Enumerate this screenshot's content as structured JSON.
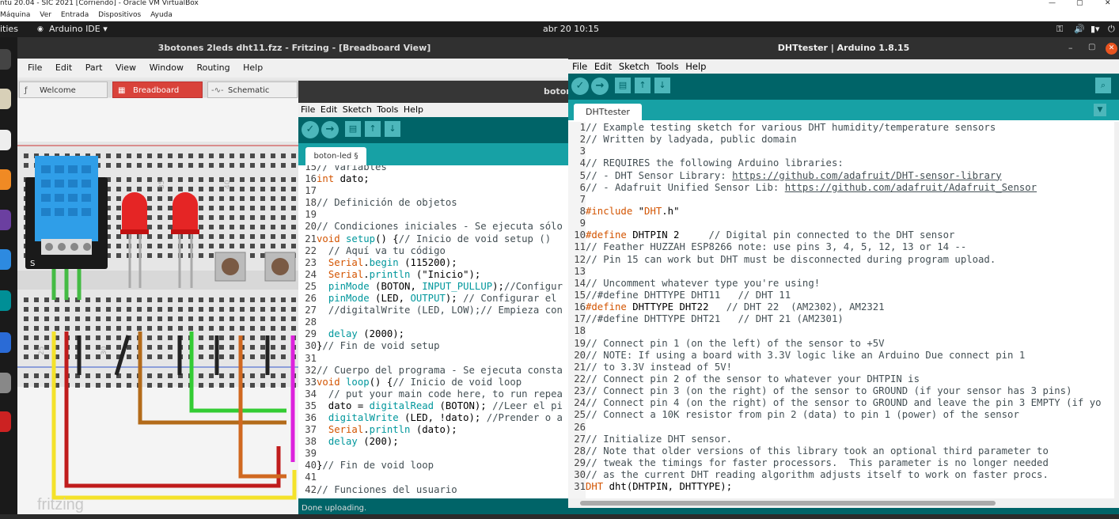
{
  "vb": {
    "title": "ntu 20.04 - SIC 2021 [Corriendo] - Oracle VM VirtualBox",
    "menu": [
      "Máquina",
      "Ver",
      "Entrada",
      "Dispositivos",
      "Ayuda"
    ],
    "window_controls": [
      "—",
      "▢",
      "✕"
    ]
  },
  "topbar": {
    "activities": "ities",
    "app": "Arduino IDE ▾",
    "datetime": "abr 20  10:15"
  },
  "fritzing": {
    "title": "3botones 2leds dht11.fzz - Fritzing - [Breadboard View]",
    "menu": [
      "File",
      "Edit",
      "Part",
      "View",
      "Window",
      "Routing",
      "Help"
    ],
    "tabs": [
      "Welcome",
      "Breadboard",
      "Schematic"
    ],
    "logo": "fritzing",
    "ruler": [
      "25",
      "30",
      "35",
      "40"
    ]
  },
  "small_ide": {
    "title": "boton",
    "menu": [
      "File",
      "Edit",
      "Sketch",
      "Tools",
      "Help"
    ],
    "tab": "boton-led §",
    "status": "Done uploading.",
    "lines": [
      {
        "n": "15",
        "t": "// Variables"
      },
      {
        "n": "16",
        "t": "int dato;"
      },
      {
        "n": "17",
        "t": ""
      },
      {
        "n": "18",
        "t": "// Definición de objetos"
      },
      {
        "n": "19",
        "t": ""
      },
      {
        "n": "20",
        "t": "// Condiciones iniciales - Se ejecuta sólo"
      },
      {
        "n": "21",
        "t": "void setup() {// Inicio de void setup ()"
      },
      {
        "n": "22",
        "t": "  // Aquí va tu código"
      },
      {
        "n": "23",
        "t": "  Serial.begin (115200);"
      },
      {
        "n": "24",
        "t": "  Serial.println (\"Inicio\");"
      },
      {
        "n": "25",
        "t": "  pinMode (BOTON, INPUT_PULLUP);//Configur"
      },
      {
        "n": "26",
        "t": "  pinMode (LED, OUTPUT); // Configurar el"
      },
      {
        "n": "27",
        "t": "  //digitalWrite (LED, LOW);// Empieza con"
      },
      {
        "n": "28",
        "t": ""
      },
      {
        "n": "29",
        "t": "  delay (2000);"
      },
      {
        "n": "30",
        "t": "}// Fin de void setup"
      },
      {
        "n": "31",
        "t": ""
      },
      {
        "n": "32",
        "t": "// Cuerpo del programa - Se ejecuta consta"
      },
      {
        "n": "33",
        "t": "void loop() {// Inicio de void loop"
      },
      {
        "n": "34",
        "t": "  // put your main code here, to run repea"
      },
      {
        "n": "35",
        "t": "  dato = digitalRead (BOTON); //Leer el pi"
      },
      {
        "n": "36",
        "t": "  digitalWrite (LED, !dato); //Prender o a"
      },
      {
        "n": "37",
        "t": "  Serial.println (dato);"
      },
      {
        "n": "38",
        "t": "  delay (200);"
      },
      {
        "n": "39",
        "t": ""
      },
      {
        "n": "40",
        "t": "}// Fin de void loop"
      },
      {
        "n": "41",
        "t": ""
      },
      {
        "n": "42",
        "t": "// Funciones del usuario"
      }
    ]
  },
  "main_ide": {
    "title": "DHTtester | Arduino 1.8.15",
    "menu": [
      "File",
      "Edit",
      "Sketch",
      "Tools",
      "Help"
    ],
    "tab": "DHTtester",
    "lines": [
      {
        "n": "1",
        "t": "// Example testing sketch for various DHT humidity/temperature sensors"
      },
      {
        "n": "2",
        "t": "// Written by ladyada, public domain"
      },
      {
        "n": "3",
        "t": ""
      },
      {
        "n": "4",
        "t": "// REQUIRES the following Arduino libraries:"
      },
      {
        "n": "5",
        "t": "// - DHT Sensor Library: https://github.com/adafruit/DHT-sensor-library"
      },
      {
        "n": "6",
        "t": "// - Adafruit Unified Sensor Lib: https://github.com/adafruit/Adafruit_Sensor"
      },
      {
        "n": "7",
        "t": ""
      },
      {
        "n": "8",
        "t": "#include \"DHT.h\""
      },
      {
        "n": "9",
        "t": ""
      },
      {
        "n": "10",
        "t": "#define DHTPIN 2     // Digital pin connected to the DHT sensor"
      },
      {
        "n": "11",
        "t": "// Feather HUZZAH ESP8266 note: use pins 3, 4, 5, 12, 13 or 14 --"
      },
      {
        "n": "12",
        "t": "// Pin 15 can work but DHT must be disconnected during program upload."
      },
      {
        "n": "13",
        "t": ""
      },
      {
        "n": "14",
        "t": "// Uncomment whatever type you're using!"
      },
      {
        "n": "15",
        "t": "//#define DHTTYPE DHT11   // DHT 11"
      },
      {
        "n": "16",
        "t": "#define DHTTYPE DHT22   // DHT 22  (AM2302), AM2321"
      },
      {
        "n": "17",
        "t": "//#define DHTTYPE DHT21   // DHT 21 (AM2301)"
      },
      {
        "n": "18",
        "t": ""
      },
      {
        "n": "19",
        "t": "// Connect pin 1 (on the left) of the sensor to +5V"
      },
      {
        "n": "20",
        "t": "// NOTE: If using a board with 3.3V logic like an Arduino Due connect pin 1"
      },
      {
        "n": "21",
        "t": "// to 3.3V instead of 5V!"
      },
      {
        "n": "22",
        "t": "// Connect pin 2 of the sensor to whatever your DHTPIN is"
      },
      {
        "n": "23",
        "t": "// Connect pin 3 (on the right) of the sensor to GROUND (if your sensor has 3 pins)"
      },
      {
        "n": "24",
        "t": "// Connect pin 4 (on the right) of the sensor to GROUND and leave the pin 3 EMPTY (if yo"
      },
      {
        "n": "25",
        "t": "// Connect a 10K resistor from pin 2 (data) to pin 1 (power) of the sensor"
      },
      {
        "n": "26",
        "t": ""
      },
      {
        "n": "27",
        "t": "// Initialize DHT sensor."
      },
      {
        "n": "28",
        "t": "// Note that older versions of this library took an optional third parameter to"
      },
      {
        "n": "29",
        "t": "// tweak the timings for faster processors.  This parameter is no longer needed"
      },
      {
        "n": "30",
        "t": "// as the current DHT reading algorithm adjusts itself to work on faster procs."
      },
      {
        "n": "31",
        "t": "DHT dht(DHTPIN, DHTTYPE);"
      }
    ]
  }
}
